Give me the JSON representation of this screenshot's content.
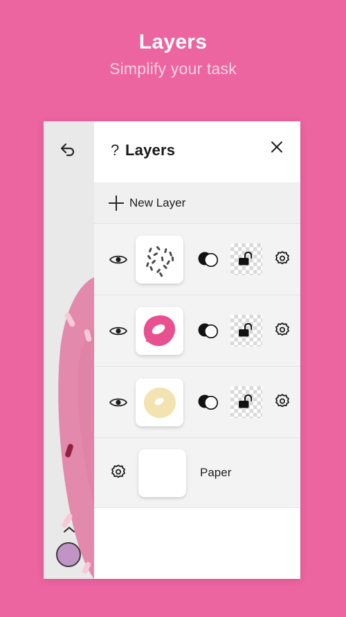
{
  "promo": {
    "title": "Layers",
    "subtitle": "Simplify your task"
  },
  "colors": {
    "background_pink": "#ec64a0",
    "promo_title": "#ffffff",
    "promo_subtitle": "#fcd3e4",
    "panel_background": "#ffffff",
    "row_background": "#f3f3f3",
    "tool_rail": "#e9e9e9",
    "color_swatch": "#c194c6",
    "frosting_pink": "#e8508f",
    "dough_cream": "#f2e3b0",
    "canvas_donut": "#e389ab",
    "sprinkle_dark": "#8c2440",
    "sprinkle_light": "#f7c9d8"
  },
  "tool_rail": {
    "undo_icon": "undo-arrow-icon",
    "collapse_icon": "chevron-up-icon",
    "color_swatch_label": "color-swatch"
  },
  "panel": {
    "help_icon": "?",
    "title": "Layers",
    "close_icon": "close-x-icon",
    "new_layer_label": "New Layer",
    "plus_icon": "plus-icon"
  },
  "layers": [
    {
      "index": 0,
      "thumbnail": "sprinkles-thumbnail",
      "visible": true,
      "visibility_icon": "eye-icon",
      "blend_icon": "blend-mode-icon",
      "lock_icon": "unlocked-padlock-icon",
      "locked": false,
      "settings_icon": "gear-icon"
    },
    {
      "index": 1,
      "thumbnail": "pink-frosting-donut-thumbnail",
      "visible": true,
      "visibility_icon": "eye-icon",
      "blend_icon": "blend-mode-icon",
      "lock_icon": "unlocked-padlock-icon",
      "locked": false,
      "settings_icon": "gear-icon"
    },
    {
      "index": 2,
      "thumbnail": "cream-donut-base-thumbnail",
      "visible": true,
      "visibility_icon": "eye-icon",
      "blend_icon": "blend-mode-icon",
      "lock_icon": "unlocked-padlock-icon",
      "locked": false,
      "settings_icon": "gear-icon"
    }
  ],
  "paper_row": {
    "label": "Paper",
    "settings_icon": "gear-icon",
    "thumbnail": "white-paper-thumbnail"
  }
}
